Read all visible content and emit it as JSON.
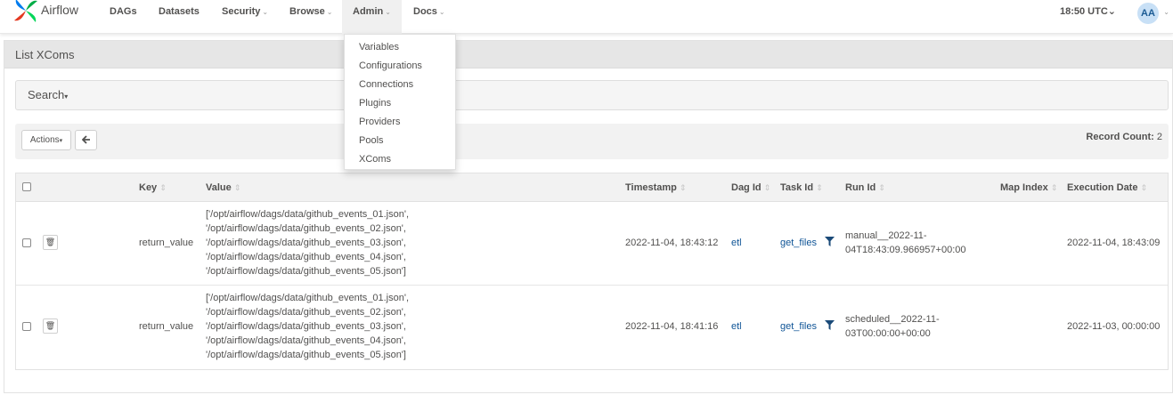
{
  "brand": {
    "name": "Airflow"
  },
  "nav": {
    "items": [
      {
        "label": "DAGs"
      },
      {
        "label": "Datasets"
      },
      {
        "label": "Security"
      },
      {
        "label": "Browse"
      },
      {
        "label": "Admin"
      },
      {
        "label": "Docs"
      }
    ],
    "time": "18:50 UTC",
    "avatar": "AA"
  },
  "admin_menu": {
    "items": [
      "Variables",
      "Configurations",
      "Connections",
      "Plugins",
      "Providers",
      "Pools",
      "XComs"
    ]
  },
  "panel": {
    "title": "List XComs",
    "search_label": "Search",
    "actions_label": "Actions",
    "back_icon": "arrow-left-icon",
    "record_count_label": "Record Count:",
    "record_count": "2"
  },
  "table": {
    "columns": [
      "Key",
      "Value",
      "Timestamp",
      "Dag Id",
      "Task Id",
      "Run Id",
      "Map Index",
      "Execution Date"
    ],
    "rows": [
      {
        "key": "return_value",
        "value": [
          "['/opt/airflow/dags/data/github_events_01.json',",
          "'/opt/airflow/dags/data/github_events_02.json',",
          "'/opt/airflow/dags/data/github_events_03.json',",
          "'/opt/airflow/dags/data/github_events_04.json',",
          "'/opt/airflow/dags/data/github_events_05.json']"
        ],
        "timestamp": "2022-11-04, 18:43:12",
        "dag_id": "etl",
        "task_id": "get_files",
        "run_id": [
          "manual__2022-11-",
          "04T18:43:09.966957+00:00"
        ],
        "map_index": "",
        "execution_date": "2022-11-04, 18:43:09"
      },
      {
        "key": "return_value",
        "value": [
          "['/opt/airflow/dags/data/github_events_01.json',",
          "'/opt/airflow/dags/data/github_events_02.json',",
          "'/opt/airflow/dags/data/github_events_03.json',",
          "'/opt/airflow/dags/data/github_events_04.json',",
          "'/opt/airflow/dags/data/github_events_05.json']"
        ],
        "timestamp": "2022-11-04, 18:41:16",
        "dag_id": "etl",
        "task_id": "get_files",
        "run_id": [
          "scheduled__2022-11-",
          "03T00:00:00+00:00"
        ],
        "map_index": "",
        "execution_date": "2022-11-03, 00:00:00"
      }
    ]
  },
  "colors": {
    "link": "#0f5496",
    "text": "#51504f",
    "brand_blue": "#017cee",
    "brand_red": "#e43921",
    "brand_green": "#00ad46",
    "brand_teal": "#04d659"
  }
}
